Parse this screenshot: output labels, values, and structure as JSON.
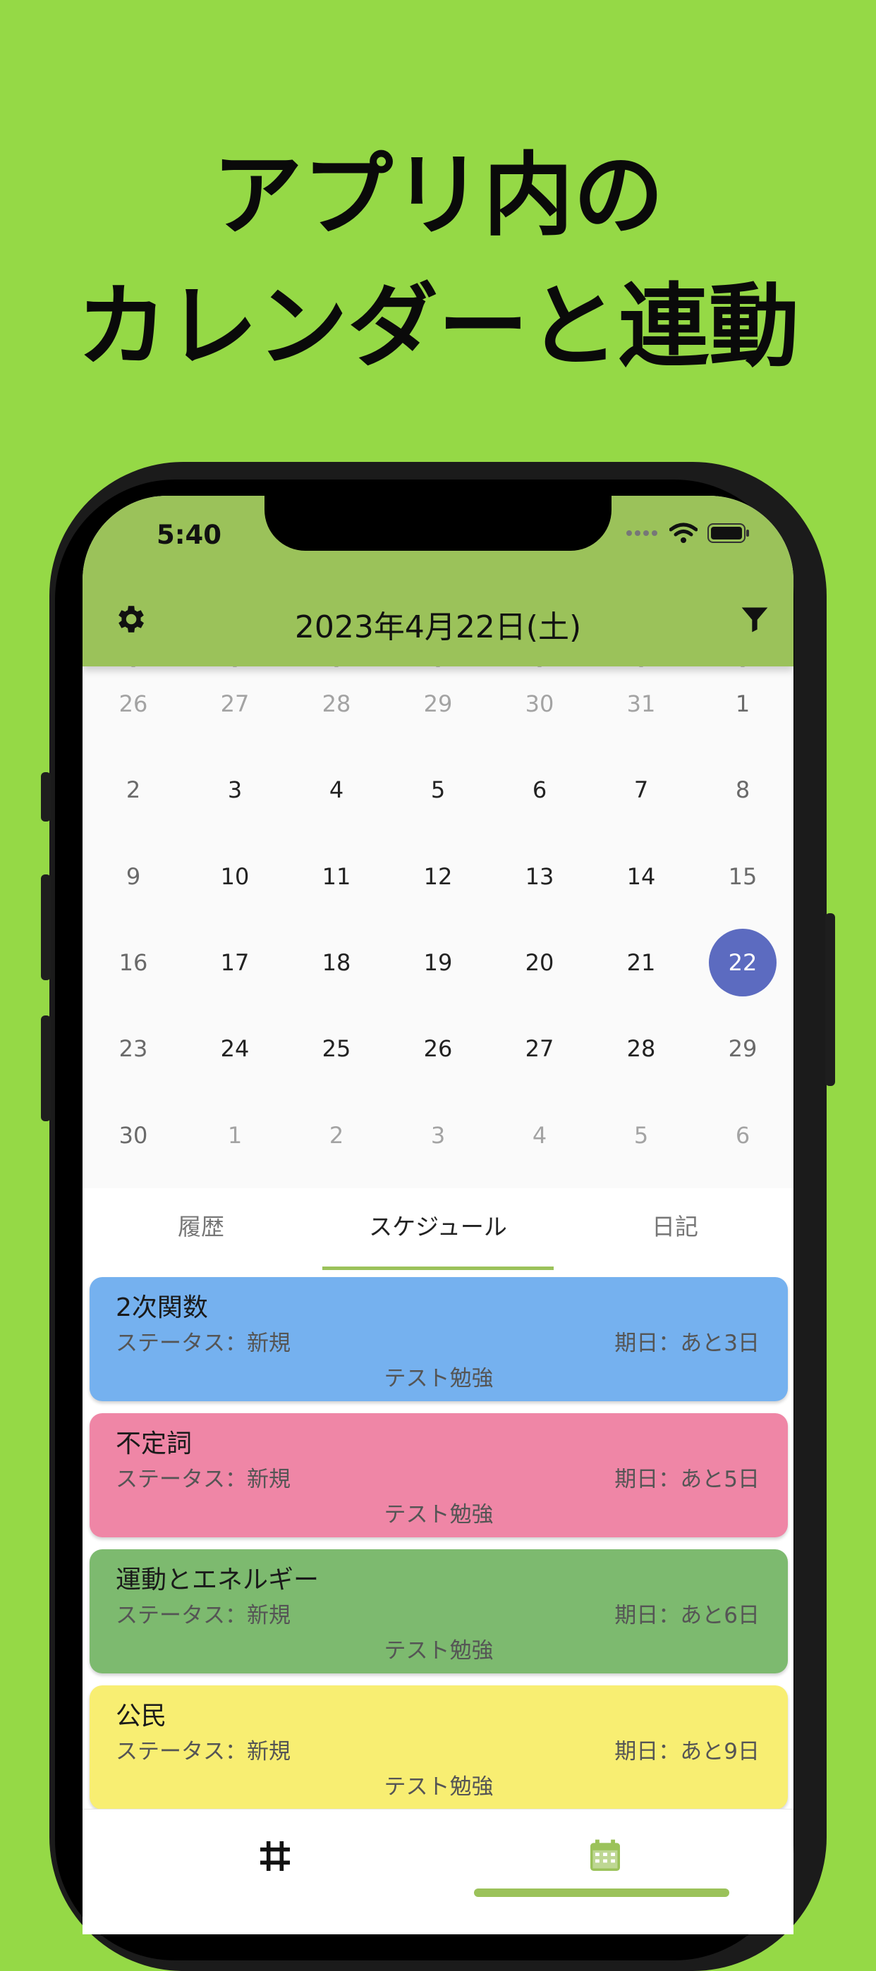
{
  "promo": {
    "line1": "アプリ内の",
    "line2": "カレンダーと連動"
  },
  "statusbar": {
    "time": "5:40",
    "icons": [
      "signal-dots-icon",
      "wifi-icon",
      "battery-icon"
    ]
  },
  "appbar": {
    "title": "2023年4月22日(土)",
    "left_icon": "gear-icon",
    "right_icon": "filter-icon",
    "color": "#9bc25a"
  },
  "calendar": {
    "weeks": [
      [
        "26",
        "27",
        "28",
        "29",
        "30",
        "31",
        "1"
      ],
      [
        "2",
        "3",
        "4",
        "5",
        "6",
        "7",
        "8"
      ],
      [
        "9",
        "10",
        "11",
        "12",
        "13",
        "14",
        "15"
      ],
      [
        "16",
        "17",
        "18",
        "19",
        "20",
        "21",
        "22"
      ],
      [
        "23",
        "24",
        "25",
        "26",
        "27",
        "28",
        "29"
      ],
      [
        "30",
        "1",
        "2",
        "3",
        "4",
        "5",
        "6"
      ]
    ],
    "selected_day": "22",
    "selected_color": "#5c6bc0"
  },
  "tabs": {
    "items": [
      "履歴",
      "スケジュール",
      "日記"
    ],
    "active": "スケジュール"
  },
  "schedule": [
    {
      "name": "2次関数",
      "status": "ステータス：新規",
      "due": "期日：あと3日",
      "category": "テスト勉強",
      "color": "#75b1ef"
    },
    {
      "name": "不定詞",
      "status": "ステータス：新規",
      "due": "期日：あと5日",
      "category": "テスト勉強",
      "color": "#ef86a6"
    },
    {
      "name": "運動とエネルギー",
      "status": "ステータス：新規",
      "due": "期日：あと6日",
      "category": "テスト勉強",
      "color": "#7dba6f"
    },
    {
      "name": "公民",
      "status": "ステータス：新規",
      "due": "期日：あと9日",
      "category": "テスト勉強",
      "color": "#f8ee72"
    }
  ],
  "bottomnav": {
    "items": [
      "hash-icon",
      "calendar-icon"
    ],
    "active": "calendar-icon"
  }
}
